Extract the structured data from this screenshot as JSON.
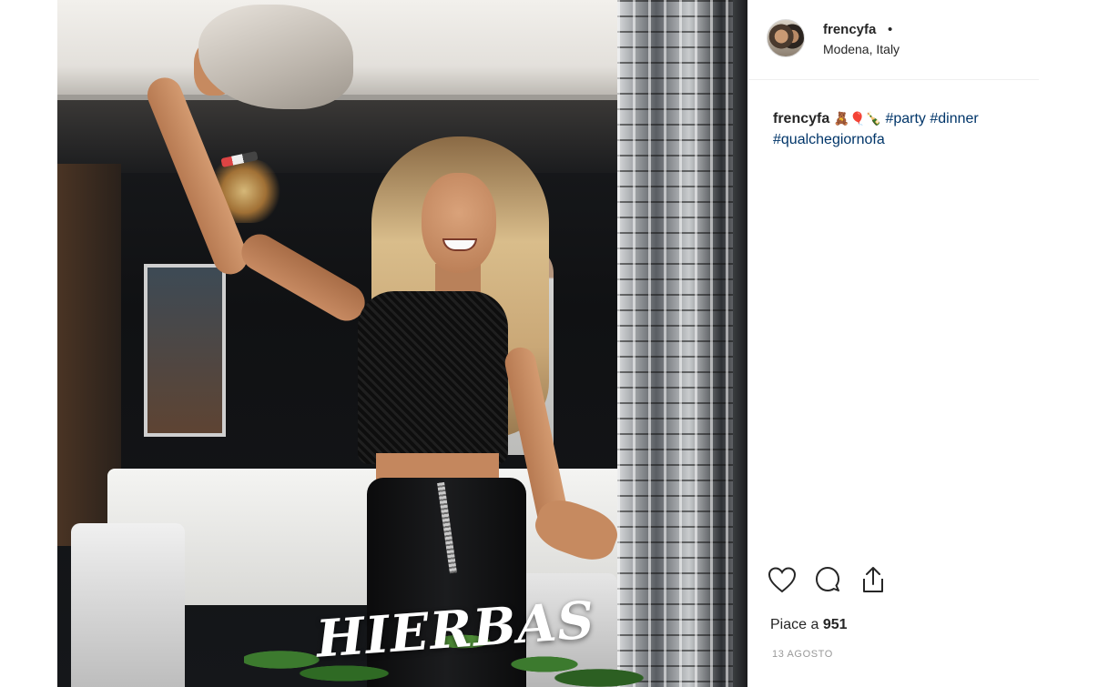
{
  "post": {
    "username": "frencyfa",
    "separator": "•",
    "location": "Modena, Italy",
    "caption": {
      "username": "frencyfa",
      "emoji": "🧸🎈🍾",
      "tags": [
        "#party",
        "#dinner",
        "#qualchegiornofa"
      ]
    },
    "likes_label": "Piace a",
    "likes_count": "951",
    "date": "13 AGOSTO"
  },
  "photo": {
    "logo_text": "HIERBAS"
  },
  "icons": {
    "like": "heart-icon",
    "comment": "comment-icon",
    "share": "share-icon"
  },
  "colors": {
    "hashtag": "#003569",
    "text": "#262626",
    "muted": "#999999",
    "divider": "#efefef"
  }
}
